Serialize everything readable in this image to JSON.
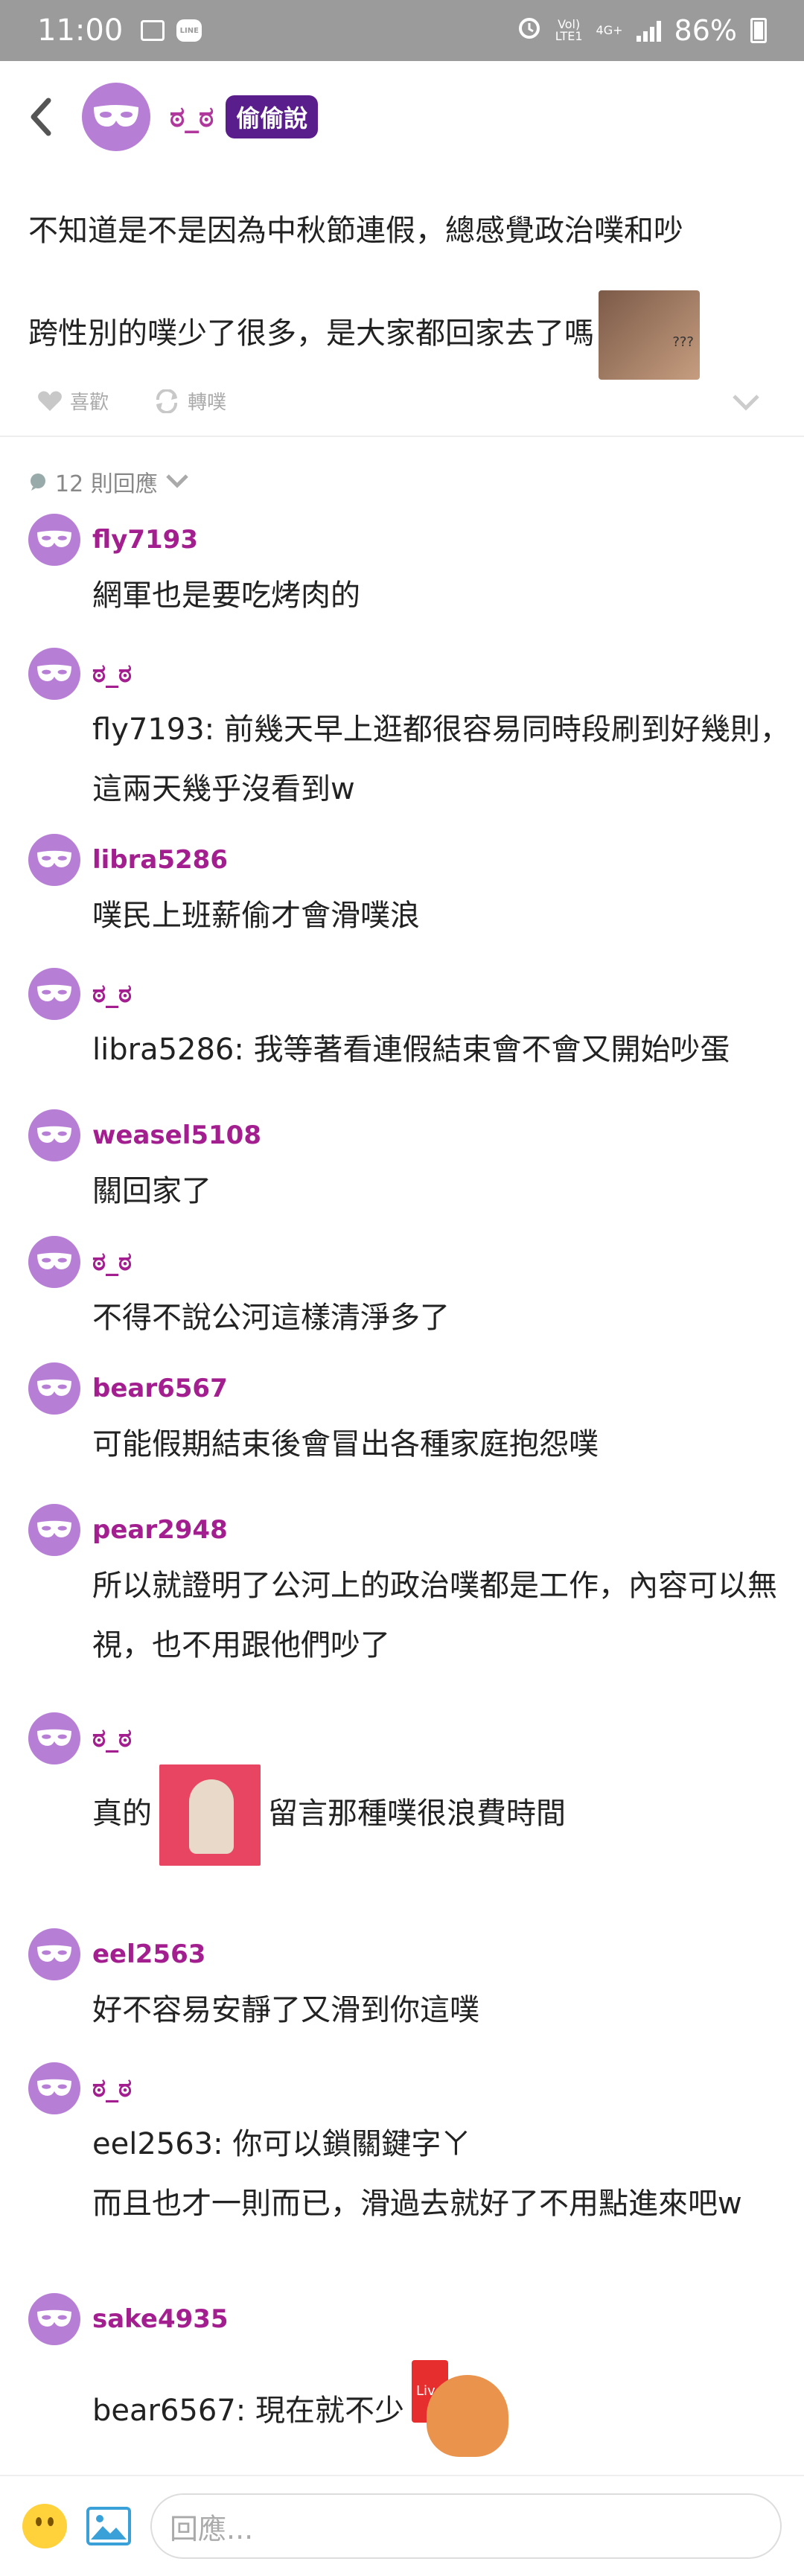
{
  "status_bar": {
    "time": "11:00",
    "network_top": "Vol)",
    "network_bottom": "LTE1",
    "net_4g": "4G+",
    "battery": "86%",
    "line_icon": "LINE"
  },
  "header": {
    "user": "ಠ_ಠ",
    "badge": "偷偷說"
  },
  "post": {
    "line1": "不知道是不是因為中秋節連假，總感覺政治噗和吵",
    "line2": "跨性別的噗少了很多，是大家都回家去了嗎",
    "like": "喜歡",
    "replurk": "轉噗"
  },
  "reply_count": "12 則回應",
  "comments": [
    {
      "name": "fly7193",
      "text": "網軍也是要吃烤肉的"
    },
    {
      "name": "ಠ_ಠ",
      "text": "fly7193: 前幾天早上逛都很容易同時段刷到好幾則，這兩天幾乎沒看到w"
    },
    {
      "name": "libra5286",
      "text": "噗民上班薪偷才會滑噗浪"
    },
    {
      "name": "ಠ_ಠ",
      "text": "libra5286: 我等著看連假結束會不會又開始吵蛋"
    },
    {
      "name": "weasel5108",
      "text": "關回家了"
    },
    {
      "name": "ಠ_ಠ",
      "text": "不得不說公河這樣清淨多了"
    },
    {
      "name": "bear6567",
      "text": "可能假期結束後會冒出各種家庭抱怨噗"
    },
    {
      "name": "pear2948",
      "text": "所以就證明了公河上的政治噗都是工作，內容可以無視，也不用跟他們吵了"
    },
    {
      "name": "ಠ_ಠ",
      "text_before": "真的",
      "text_after": "留言那種噗很浪費時間"
    },
    {
      "name": "eel2563",
      "text": "好不容易安靜了又滑到你這噗"
    },
    {
      "name": "ಠ_ಠ",
      "text1": "eel2563: 你可以鎖關鍵字ㄚ",
      "text2": "而且也才一則而已，滑過去就好了不用點進來吧w"
    },
    {
      "name": "sake4935",
      "text": "bear6567: 現在就不少",
      "live": "Live"
    }
  ],
  "input": {
    "placeholder": "回應..."
  },
  "colors": {
    "accent": "#a31e8f",
    "avatar": "#b77ed6",
    "badge": "#5a1d8c"
  }
}
